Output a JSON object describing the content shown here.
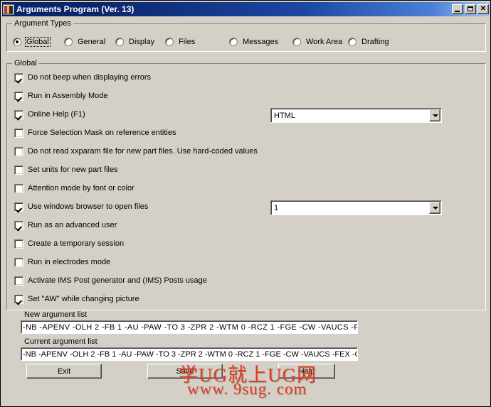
{
  "window": {
    "title": "Arguments Program (Ver. 13)",
    "icon": "books-icon",
    "controls": {
      "minimize": "_",
      "maximize": "□",
      "close": "✕"
    }
  },
  "argument_types": {
    "group_title": "Argument Types",
    "options": [
      {
        "label": "Global",
        "checked": true,
        "focused": true
      },
      {
        "label": "General",
        "checked": false,
        "focused": false
      },
      {
        "label": "Display",
        "checked": false,
        "focused": false
      },
      {
        "label": "Files",
        "checked": false,
        "focused": false
      },
      {
        "label": "Messages",
        "checked": false,
        "focused": false
      },
      {
        "label": "Work Area",
        "checked": false,
        "focused": false
      },
      {
        "label": "Drafting",
        "checked": false,
        "focused": false
      }
    ]
  },
  "global": {
    "group_title": "Global",
    "checkboxes": [
      {
        "label": "Do not beep when displaying errors",
        "checked": true
      },
      {
        "label": "Run in Assembly Mode",
        "checked": true
      },
      {
        "label": "Online Help (F1)",
        "checked": true
      },
      {
        "label": "Force Selection Mask on reference entities",
        "checked": false
      },
      {
        "label": "Do not read xxparam file for new part files. Use hard-coded values",
        "checked": false
      },
      {
        "label": "Set units for new part files",
        "checked": false
      },
      {
        "label": "Attention mode by font or color",
        "checked": false
      },
      {
        "label": "Use windows browser to open files",
        "checked": true
      },
      {
        "label": "Run as an advanced user",
        "checked": true
      },
      {
        "label": "Create a temporary session",
        "checked": false
      },
      {
        "label": "Run in electrodes mode",
        "checked": false
      },
      {
        "label": "Activate IMS Post generator and (IMS) Posts usage",
        "checked": false
      },
      {
        "label": "Set \"AW\" while changing picture",
        "checked": true
      }
    ],
    "help_format_combo": {
      "value": "HTML"
    },
    "browser_combo": {
      "value": "1"
    }
  },
  "arguments": {
    "new_label": "New argument list",
    "new_value": "-NB  -APENV  -OLH 2 -FB 1 -AU  -PAW  -TO 3 -ZPR 2 -WTM 0 -RCZ 1 -FGE  -CW  -VAUCS  -FEX",
    "current_label": "Current argument list",
    "current_value": "-NB -APENV -OLH 2 -FB 1 -AU -PAW -TO 3 -ZPR 2 -WTM 0 -RCZ 1 -FGE -CW -VAUCS -FEX -OL"
  },
  "buttons": {
    "exit": "Exit",
    "save": "Save",
    "help": "Help"
  },
  "watermark": {
    "line1": "学UG就上UG网",
    "line2": "www. 9sug. com",
    "color": "#e03a1a"
  }
}
